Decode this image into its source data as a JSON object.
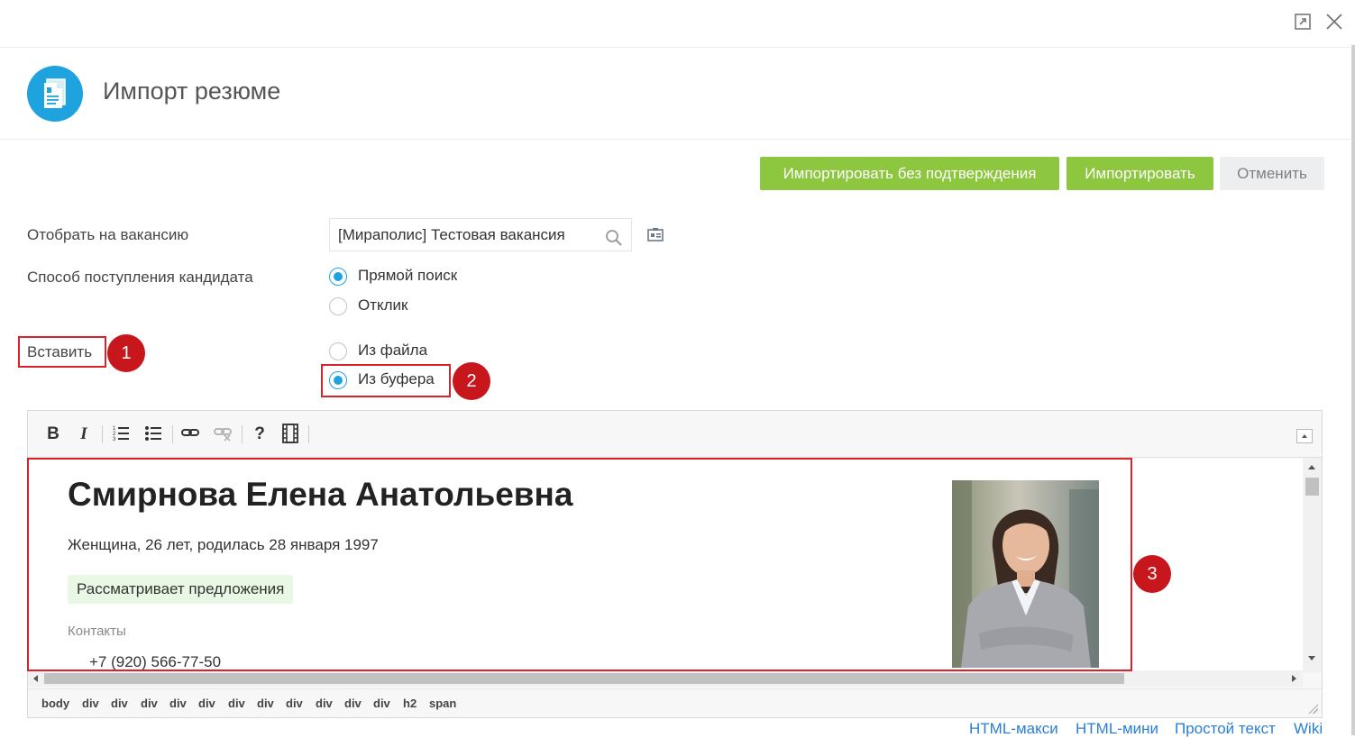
{
  "dialog": {
    "title": "Импорт резюме"
  },
  "actions": {
    "import_no_confirm": "Импортировать без подтверждения",
    "import": "Импортировать",
    "cancel": "Отменить"
  },
  "form": {
    "vacancy_label": "Отобрать на вакансию",
    "vacancy_value": "[Мираполис] Тестовая вакансия",
    "source_label": "Способ поступления кандидата",
    "source_options": [
      {
        "label": "Прямой поиск",
        "selected": true
      },
      {
        "label": "Отклик",
        "selected": false
      }
    ],
    "insert_label": "Вставить",
    "insert_options": [
      {
        "label": "Из файла",
        "selected": false
      },
      {
        "label": "Из буфера",
        "selected": true
      }
    ]
  },
  "annotations": [
    "1",
    "2",
    "3"
  ],
  "accent_colors": {
    "primary": "#1fa3df",
    "green": "#8dc63f",
    "annotation_red": "#d9232a"
  },
  "editor": {
    "toolbar": [
      "bold-icon",
      "italic-icon",
      "ordered-list-icon",
      "bullet-list-icon",
      "link-icon",
      "unlink-icon",
      "help-icon",
      "media-icon"
    ],
    "resume": {
      "name": "Смирнова Елена Анатольевна",
      "subtitle": "Женщина, 26 лет, родилась 28 января 1997",
      "status": "Рассматривает предложения",
      "contacts_heading": "Контакты",
      "phone": "+7 (920) 566-77-50"
    },
    "path": [
      "body",
      "div",
      "div",
      "div",
      "div",
      "div",
      "div",
      "div",
      "div",
      "div",
      "div",
      "div",
      "h2",
      "span"
    ]
  },
  "modes": [
    "HTML-макси",
    "HTML-мини",
    "Простой текст",
    "Wiki"
  ]
}
